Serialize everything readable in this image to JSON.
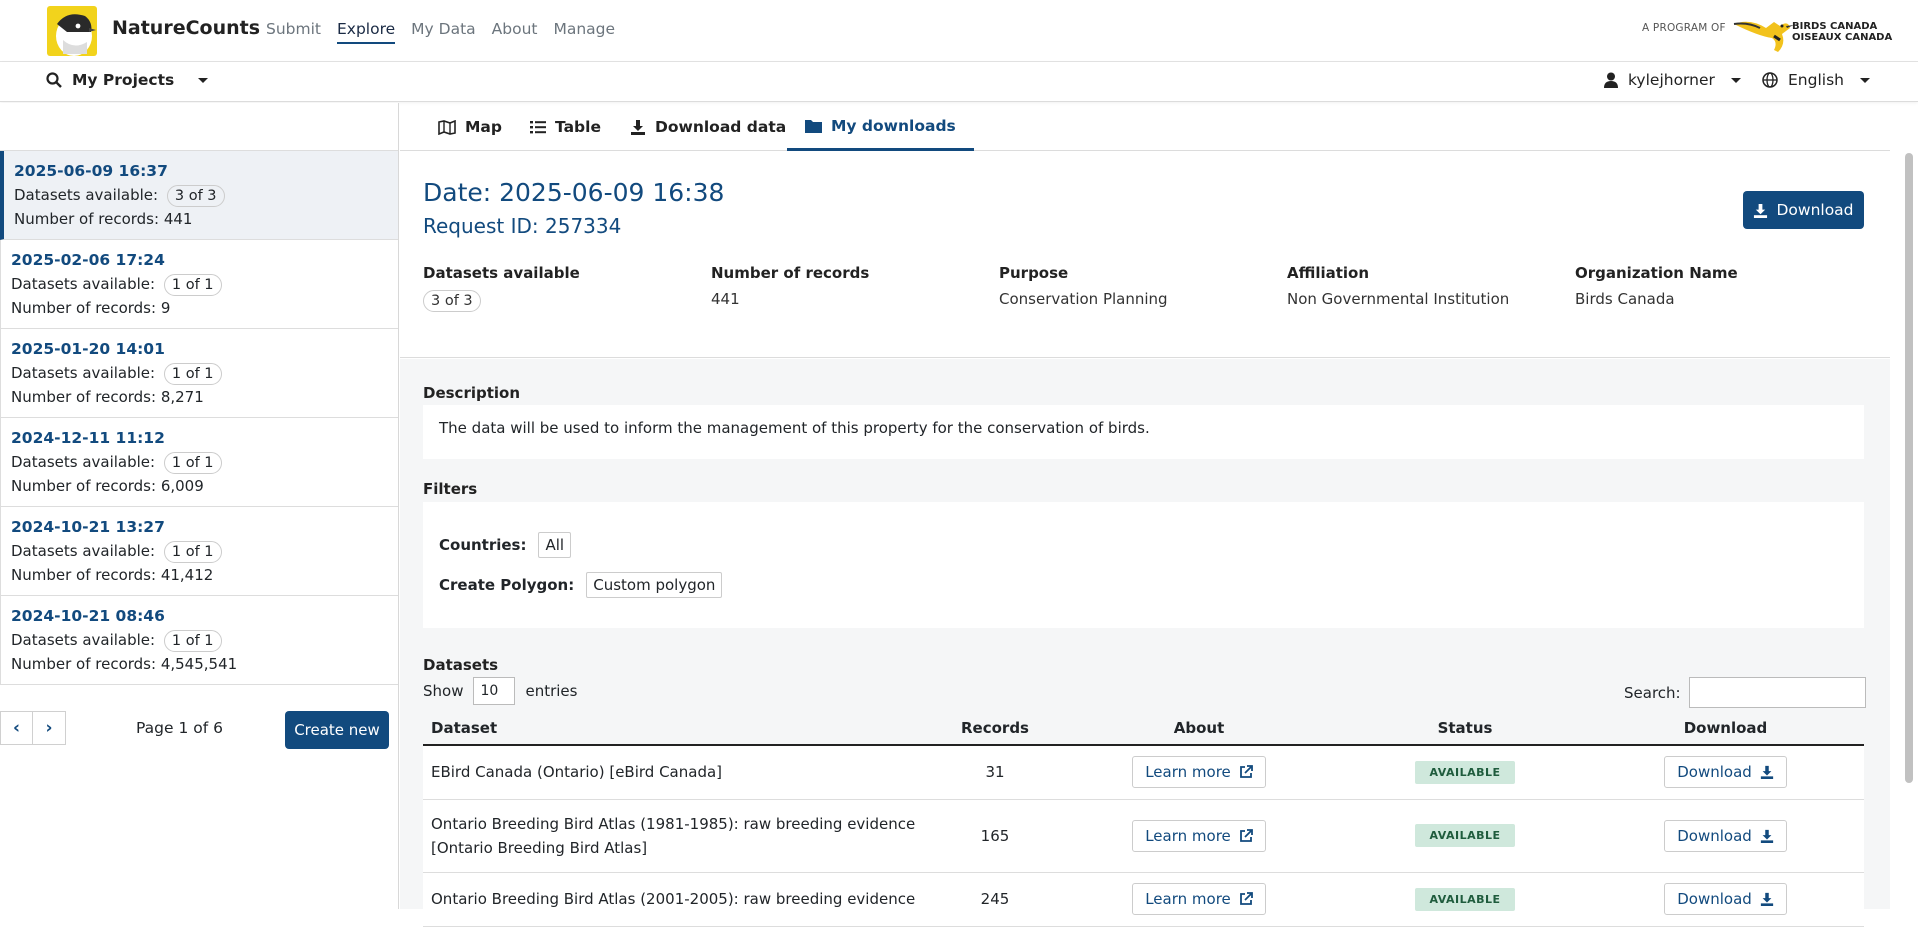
{
  "app": {
    "brand": "NatureCounts",
    "program_label": "A PROGRAM OF",
    "partner_line1": "BIRDS CANADA",
    "partner_line2": "OISEAUX CANADA"
  },
  "nav": [
    "Submit",
    "Explore",
    "My Data",
    "About",
    "Manage"
  ],
  "nav_active": "Explore",
  "subbar": {
    "projects_label": "My Projects",
    "username": "kylejhorner",
    "language": "English"
  },
  "sidebar": {
    "labels": {
      "datasets": "Datasets available:",
      "records": "Number of records:"
    },
    "requests": [
      {
        "date": "2025-06-09 16:37",
        "datasets": "3 of 3",
        "records": "441",
        "active": true
      },
      {
        "date": "2025-02-06 17:24",
        "datasets": "1 of 1",
        "records": "9"
      },
      {
        "date": "2025-01-20 14:01",
        "datasets": "1 of 1",
        "records": "8,271"
      },
      {
        "date": "2024-12-11 11:12",
        "datasets": "1 of 1",
        "records": "6,009"
      },
      {
        "date": "2024-10-21 13:27",
        "datasets": "1 of 1",
        "records": "41,412"
      },
      {
        "date": "2024-10-21 08:46",
        "datasets": "1 of 1",
        "records": "4,545,541"
      }
    ],
    "page_text": "Page 1 of 6",
    "prev_icon": "chevron-left-icon",
    "next_icon": "chevron-right-icon",
    "create_label": "Create new"
  },
  "tabs": {
    "map": "Map",
    "table": "Table",
    "download": "Download data",
    "my_downloads": "My downloads"
  },
  "detail": {
    "date_title": "Date: 2025-06-09 16:38",
    "request_id": "Request ID: 257334",
    "download_label": "Download",
    "meta": {
      "datasets_label": "Datasets available",
      "datasets_value": "3 of 3",
      "records_label": "Number of records",
      "records_value": "441",
      "purpose_label": "Purpose",
      "purpose_value": "Conservation Planning",
      "affiliation_label": "Affiliation",
      "affiliation_value": "Non Governmental Institution",
      "org_label": "Organization Name",
      "org_value": "Birds Canada"
    },
    "description_title": "Description",
    "description": "The data will be used to inform the management of this property for the conservation of birds.",
    "filters_title": "Filters",
    "filters": {
      "countries_label": "Countries:",
      "countries_value": "All",
      "polygon_label": "Create Polygon:",
      "polygon_value": "Custom polygon"
    },
    "datasets_title": "Datasets",
    "show_label": "Show",
    "show_value": "10",
    "entries_label": "entries",
    "search_label": "Search:",
    "table": {
      "headers": [
        "Dataset",
        "Records",
        "About",
        "Status",
        "Download"
      ],
      "learn_more": "Learn more",
      "download": "Download",
      "rows": [
        {
          "dataset": "EBird Canada (Ontario) [eBird Canada]",
          "records": "31",
          "status": "AVAILABLE"
        },
        {
          "dataset": "Ontario Breeding Bird Atlas (1981-1985): raw breeding evidence [Ontario Breeding Bird Atlas]",
          "records": "165",
          "status": "AVAILABLE"
        },
        {
          "dataset": "Ontario Breeding Bird Atlas (2001-2005): raw breeding evidence",
          "records": "245",
          "status": "AVAILABLE"
        }
      ]
    }
  }
}
